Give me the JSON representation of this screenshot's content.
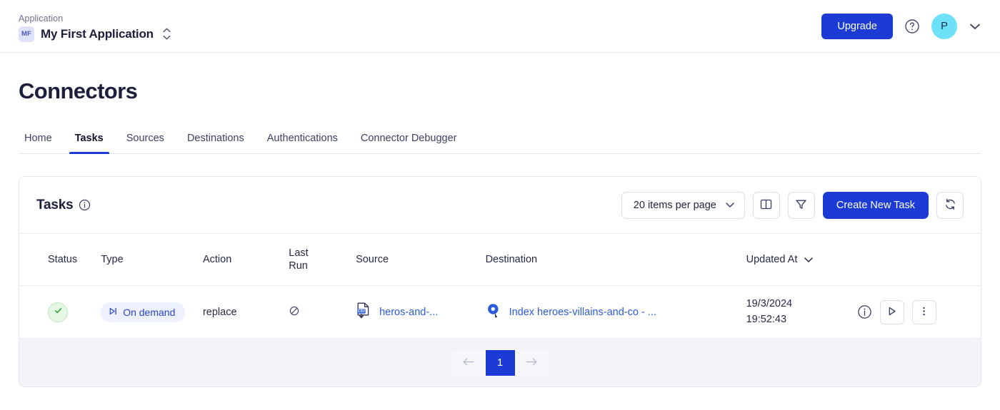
{
  "topbar": {
    "app_label": "Application",
    "app_initials": "MF",
    "app_name": "My First Application",
    "upgrade_label": "Upgrade",
    "avatar_initial": "P"
  },
  "page": {
    "title": "Connectors",
    "tabs": [
      {
        "label": "Home",
        "active": false
      },
      {
        "label": "Tasks",
        "active": true
      },
      {
        "label": "Sources",
        "active": false
      },
      {
        "label": "Destinations",
        "active": false
      },
      {
        "label": "Authentications",
        "active": false
      },
      {
        "label": "Connector Debugger",
        "active": false
      }
    ]
  },
  "card": {
    "title": "Tasks",
    "items_per_page": "20 items per page",
    "create_label": "Create New Task"
  },
  "table": {
    "columns": {
      "status": "Status",
      "type": "Type",
      "action": "Action",
      "last_run_line1": "Last",
      "last_run_line2": "Run",
      "source": "Source",
      "destination": "Destination",
      "updated_at": "Updated At"
    },
    "rows": [
      {
        "status": "success",
        "type": "On demand",
        "action": "replace",
        "last_run": "",
        "source": "heros-and-...",
        "destination": "Index heroes-villains-and-co - ...",
        "updated_date": "19/3/2024",
        "updated_time": "19:52:43"
      }
    ]
  },
  "pagination": {
    "current_page": "1"
  },
  "colors": {
    "brand_blue": "#1b3bd4",
    "link_blue": "#2b5bdb",
    "badge_bg": "#edf1fe",
    "success_bg": "#e4f7e4",
    "avatar_cyan": "#6ee0f7"
  },
  "icons": {
    "stepper": "chevron-up-down-icon",
    "help": "help-circle-icon",
    "caret": "chevron-down-icon",
    "columns": "columns-icon",
    "filter": "filter-icon",
    "refresh": "refresh-icon",
    "info": "info-circle-icon",
    "run": "play-icon",
    "more": "more-vertical-icon",
    "source": "csv-file-download-icon",
    "destination": "algolia-search-icon",
    "on_demand": "skip-forward-icon",
    "null": "no-entry-icon",
    "prev": "arrow-left-icon",
    "next": "arrow-right-icon"
  }
}
